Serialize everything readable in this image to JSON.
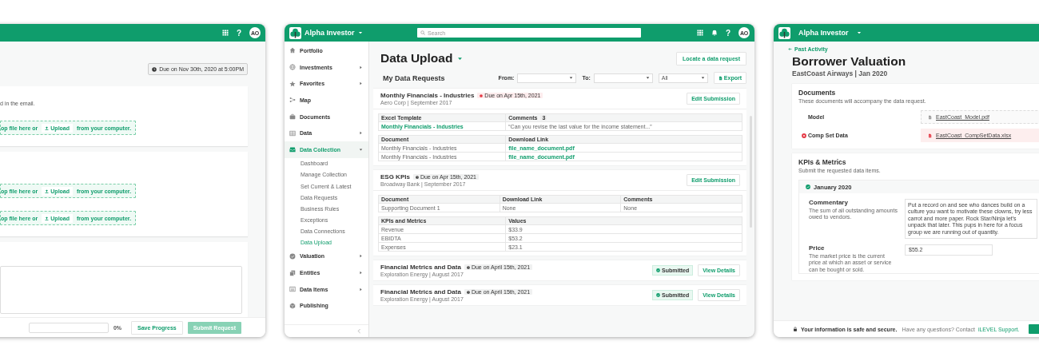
{
  "left_window": {
    "header": {
      "help": "?",
      "avatar": "AO"
    },
    "due": "Due on Nov 30th, 2020 at 5:00PM",
    "sections": [
      {
        "note": "d in the email.",
        "dropzones": [
          {
            "lead": "op file here or",
            "button": "Upload",
            "trail": "from your computer."
          }
        ]
      },
      {
        "dropzones": [
          {
            "lead": "op file here or",
            "button": "Upload",
            "trail": "from your computer."
          },
          {
            "lead": "op file here or",
            "button": "Upload",
            "trail": "from your computer."
          }
        ]
      }
    ],
    "footer": {
      "level": 0,
      "progress": "0%",
      "buttons": [
        {
          "kind": "secondary",
          "label": "Save Progress",
          "disabled": false
        },
        {
          "kind": "primary",
          "label": "Submit Request",
          "disabled": true
        }
      ]
    }
  },
  "main_window": {
    "header": {
      "app": "Alpha Investor",
      "search_placeholder": "Search",
      "help": "?",
      "avatar": "AO"
    },
    "sidebar": {
      "items": [
        {
          "label": "Portfolio",
          "submenu": false,
          "selected": false
        },
        {
          "label": "Investments",
          "submenu": true,
          "expanded": false,
          "selected": false
        },
        {
          "label": "Favorites",
          "submenu": true,
          "expanded": false,
          "selected": false
        },
        {
          "label": "Map",
          "submenu": false,
          "selected": false
        },
        {
          "label": "Documents",
          "submenu": false,
          "selected": false
        },
        {
          "label": "Data",
          "submenu": true,
          "expanded": false,
          "selected": false
        },
        {
          "label": "Data Collection",
          "submenu": true,
          "expanded": true,
          "selected": true,
          "children": [
            {
              "label": "Dashboard",
              "selected": false
            },
            {
              "label": "Manage Collection",
              "selected": false
            },
            {
              "label": "Set Current & Latest",
              "selected": false
            },
            {
              "label": "Data Requests",
              "selected": false
            },
            {
              "label": "Business Rules",
              "selected": false
            },
            {
              "label": "Exceptions",
              "selected": false
            },
            {
              "label": "Data Connections",
              "selected": false
            },
            {
              "label": "Data Upload",
              "selected": true
            }
          ]
        },
        {
          "label": "Valuation",
          "submenu": true,
          "expanded": false,
          "selected": false
        },
        {
          "label": "Entities",
          "submenu": true,
          "expanded": false,
          "selected": false
        },
        {
          "label": "Data Items",
          "submenu": true,
          "expanded": false,
          "selected": false
        },
        {
          "label": "Publishing",
          "submenu": false,
          "selected": false
        }
      ]
    },
    "page": {
      "title": "Data Upload",
      "locate": "Locate a data request",
      "section": "My Data Requests",
      "filters": [
        {
          "label": "From:"
        },
        {
          "label": "To:"
        },
        {
          "value": "All"
        }
      ],
      "export": "Export",
      "cards": [
        {
          "title": "Monthly Financials - Industries",
          "due": {
            "text": "Due on Apr 15th, 2021",
            "overdue": true
          },
          "subtitle": "Aero Corp | September 2017",
          "action": "Edit Submission",
          "tables": [
            {
              "columns": [
                {
                  "label": "Excel Template",
                  "link": true
                },
                {
                  "label": "Comments",
                  "count": "3",
                  "link": false
                }
              ],
              "rows": [
                [
                  "Monthly Financials - Industries",
                  "“Can you revise the last value for the income statement...”"
                ]
              ]
            },
            {
              "columns": [
                {
                  "label": "Document",
                  "link": false
                },
                {
                  "label": "Download Link",
                  "link": true
                }
              ],
              "rows": [
                [
                  "Monthly Financials - Industries",
                  "file_name_document.pdf"
                ],
                [
                  "Monthly Financials - Industries",
                  "file_name_document.pdf"
                ]
              ]
            }
          ]
        },
        {
          "title": "ESG KPIs",
          "due": {
            "text": "Due on Apr 15th, 2021",
            "overdue": false
          },
          "subtitle": "Broadway Bank | September 2017",
          "action": "Edit Submission",
          "tables": [
            {
              "columns": [
                {
                  "label": "Document",
                  "link": false
                },
                {
                  "label": "Download Link",
                  "link": false
                },
                {
                  "label": "Comments",
                  "link": false
                }
              ],
              "rows": [
                [
                  "Supporting Document 1",
                  "None",
                  "None"
                ]
              ]
            },
            {
              "columns": [
                {
                  "label": "KPIs and Metrics",
                  "link": false
                },
                {
                  "label": "Values",
                  "link": false
                }
              ],
              "rows": [
                [
                  "Revenue",
                  "$33.9"
                ],
                [
                  "EBIDTA",
                  "$53.2"
                ],
                [
                  "Expenses",
                  "$23.1"
                ]
              ]
            }
          ]
        },
        {
          "title": "Financial Metrics and Data",
          "due": {
            "text": "Due on April 15th, 2021",
            "overdue": false
          },
          "subtitle": "Exploration Energy | August 2017",
          "status": "Submitted",
          "action": "View Details"
        },
        {
          "title": "Financial Metrics and Data",
          "due": {
            "text": "Due on April 15th, 2021",
            "overdue": false
          },
          "subtitle": "Exploration Energy | August 2017",
          "status": "Submitted",
          "action": "View Details"
        }
      ]
    }
  },
  "right_window": {
    "header": {
      "app": "Alpha Investor"
    },
    "back": "Past Activity",
    "title": "Borrower Valuation",
    "subtitle": "EastCoast Airways | Jan 2020",
    "documents": {
      "title": "Documents",
      "description": "These documents will accompany the data request.",
      "files": [
        {
          "label": "Model",
          "file": "EastCoast_Model.pdf",
          "error": false
        },
        {
          "label": "Comp Set Data",
          "file": "EastCoast_CompSetData.xlsx",
          "error": true
        }
      ]
    },
    "kpis": {
      "title": "KPIs & Metrics",
      "description": "Submit the requested data items.",
      "period": {
        "label": "January 2020",
        "complete": true
      },
      "fields": [
        {
          "kind": "textarea",
          "label": "Commentary",
          "description": "The sum of all outstanding amounts owed to vendors.",
          "value": "Put a record on and see who dances build on a culture you want to motivate these clowns, try less carrot and more paper. Rock Star/Ninja let's unpack that later. This pups in here for a focus group we are running out of quantity."
        },
        {
          "kind": "input",
          "label": "Price",
          "description": "The market price is the current price at which an asset or service can be bought or sold.",
          "value": "$55.2"
        }
      ]
    },
    "footer": {
      "secure": "Your information is safe and secure.",
      "question": "Have any questions? Contact",
      "link": "iLEVEL Support."
    }
  }
}
